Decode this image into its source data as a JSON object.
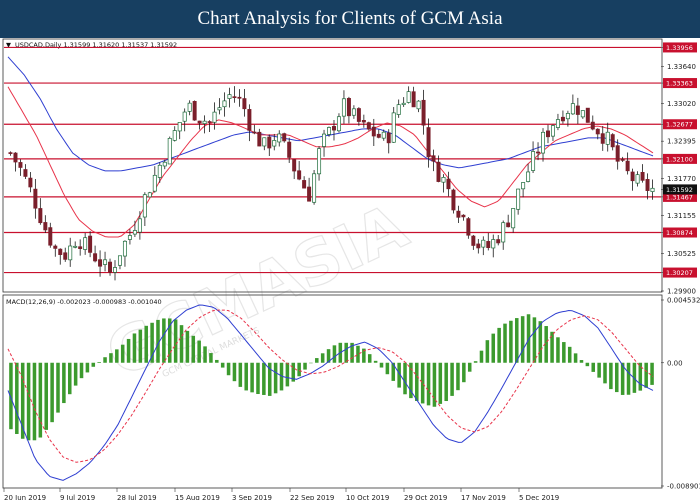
{
  "header": {
    "title": "Chart Analysis for Clients of GCM Asia"
  },
  "watermark": {
    "text": "GCMASIA",
    "subtext": "GCM CAPITAL MARKETS"
  },
  "colors": {
    "header_bg": "#173f61",
    "level_line": "#c8102e",
    "bull": "#1c6b3a",
    "bear": "#7a1f2b",
    "ma_fast": "#e8334a",
    "ma_slow": "#2f3fd1",
    "macd_hist": "#3c9a2e",
    "macd_line": "#2f3fd1",
    "signal_line": "#e8334a"
  },
  "chart_data": [
    {
      "type": "candlestick",
      "symbol_info": "USDCAD,Daily  1.31599 1.31620 1.31537 1.31592",
      "ylim": [
        1.299,
        1.3408
      ],
      "y_ticks": [
        "1.33956",
        "1.33640",
        "1.33363",
        "1.33020",
        "1.32677",
        "1.32395",
        "1.32100",
        "1.31770",
        "1.31592",
        "1.31467",
        "1.31155",
        "1.30874",
        "1.30525",
        "1.30207",
        "1.29900"
      ],
      "x_labels": [
        "20 Jun 2019",
        "9 Jul 2019",
        "28 Jul 2019",
        "15 Aug 2019",
        "3 Sep 2019",
        "22 Sep 2019",
        "10 Oct 2019",
        "29 Oct 2019",
        "17 Nov 2019",
        "5 Dec 2019"
      ],
      "levels": [
        1.33956,
        1.33363,
        1.32677,
        1.321,
        1.31467,
        1.30874,
        1.30207
      ],
      "current_price": 1.31592,
      "close_path": [
        1.322,
        1.319,
        1.315,
        1.31,
        1.306,
        1.305,
        1.308,
        1.306,
        1.304,
        1.302,
        1.306,
        1.309,
        1.314,
        1.318,
        1.322,
        1.326,
        1.33,
        1.328,
        1.327,
        1.33,
        1.332,
        1.33,
        1.325,
        1.323,
        1.325,
        1.322,
        1.318,
        1.315,
        1.323,
        1.326,
        1.33,
        1.328,
        1.326,
        1.325,
        1.324,
        1.33,
        1.332,
        1.33,
        1.32,
        1.318,
        1.314,
        1.311,
        1.307,
        1.306,
        1.308,
        1.311,
        1.316,
        1.32,
        1.324,
        1.327,
        1.329,
        1.33,
        1.328,
        1.326,
        1.324,
        1.32,
        1.318,
        1.3165,
        1.31592
      ],
      "ma_fast": [
        1.333,
        1.329,
        1.325,
        1.32,
        1.315,
        1.311,
        1.309,
        1.308,
        1.308,
        1.31,
        1.314,
        1.318,
        1.321,
        1.324,
        1.3265,
        1.3275,
        1.327,
        1.326,
        1.325,
        1.325,
        1.325,
        1.324,
        1.323,
        1.323,
        1.3235,
        1.3245,
        1.326,
        1.327,
        1.3265,
        1.325,
        1.322,
        1.319,
        1.316,
        1.314,
        1.313,
        1.314,
        1.317,
        1.32,
        1.322,
        1.324,
        1.325,
        1.326,
        1.3265,
        1.326,
        1.325,
        1.3235,
        1.322
      ],
      "ma_slow": [
        1.338,
        1.335,
        1.331,
        1.326,
        1.322,
        1.32,
        1.319,
        1.319,
        1.3195,
        1.32,
        1.321,
        1.322,
        1.323,
        1.324,
        1.325,
        1.3255,
        1.325,
        1.3245,
        1.324,
        1.3245,
        1.325,
        1.3255,
        1.326,
        1.326,
        1.325,
        1.323,
        1.321,
        1.32,
        1.3195,
        1.32,
        1.3205,
        1.321,
        1.322,
        1.323,
        1.3235,
        1.324,
        1.3245,
        1.3245,
        1.3235,
        1.3225,
        1.3215
      ]
    },
    {
      "type": "macd",
      "label": "MACD(12,26,9) -0.002023 -0.000983 -0.001040",
      "ylim": [
        -0.008901,
        0.004532
      ],
      "y_ticks": [
        "0.004532",
        "0.00",
        "-0.008901"
      ],
      "macd": [
        -0.002,
        -0.0045,
        -0.007,
        -0.0082,
        -0.0085,
        -0.008,
        -0.0072,
        -0.006,
        -0.0045,
        -0.0025,
        -0.0005,
        0.0015,
        0.003,
        0.0038,
        0.0042,
        0.004,
        0.0032,
        0.002,
        0.0008,
        -0.0004,
        -0.001,
        -0.0012,
        -0.0008,
        -0.0002,
        0.0006,
        0.0012,
        0.0015,
        0.001,
        0.0,
        -0.0015,
        -0.003,
        -0.0045,
        -0.0055,
        -0.0058,
        -0.005,
        -0.0035,
        -0.0018,
        0.0,
        0.0018,
        0.003,
        0.0036,
        0.0038,
        0.0034,
        0.0025,
        0.001,
        -0.0005,
        -0.0015,
        -0.002
      ],
      "signal": [
        0.001,
        -0.001,
        -0.0035,
        -0.0055,
        -0.0068,
        -0.0072,
        -0.007,
        -0.0063,
        -0.0052,
        -0.0038,
        -0.0022,
        -0.0005,
        0.001,
        0.0024,
        0.0033,
        0.0038,
        0.0038,
        0.0032,
        0.0022,
        0.0011,
        0.0002,
        -0.0005,
        -0.0008,
        -0.0007,
        -0.0003,
        0.0003,
        0.0009,
        0.0011,
        0.0008,
        0.0,
        -0.0012,
        -0.0025,
        -0.0038,
        -0.0047,
        -0.005,
        -0.0046,
        -0.0035,
        -0.002,
        -0.0004,
        0.0012,
        0.0024,
        0.0031,
        0.0034,
        0.0031,
        0.0022,
        0.001,
        -0.0002,
        -0.001
      ]
    }
  ]
}
